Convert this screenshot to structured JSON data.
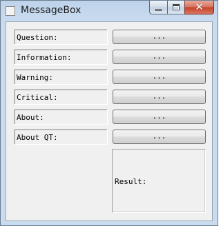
{
  "window": {
    "title": "MessageBox",
    "controls": {
      "minimize": "minimize",
      "maximize": "maximize",
      "close": "✕"
    }
  },
  "rows": [
    {
      "label": "Question:",
      "button": "..."
    },
    {
      "label": "Information:",
      "button": "..."
    },
    {
      "label": "Warning:",
      "button": "..."
    },
    {
      "label": "Critical:",
      "button": "..."
    },
    {
      "label": "About:",
      "button": "..."
    },
    {
      "label": "About QT:",
      "button": "..."
    }
  ],
  "result": {
    "label": "Result:"
  },
  "colors": {
    "titlebar": "#c9dbef",
    "client": "#f0f0f0",
    "close_button": "#c5402a"
  },
  "icons": [
    "app-icon",
    "minimize-icon",
    "maximize-icon",
    "close-icon"
  ]
}
